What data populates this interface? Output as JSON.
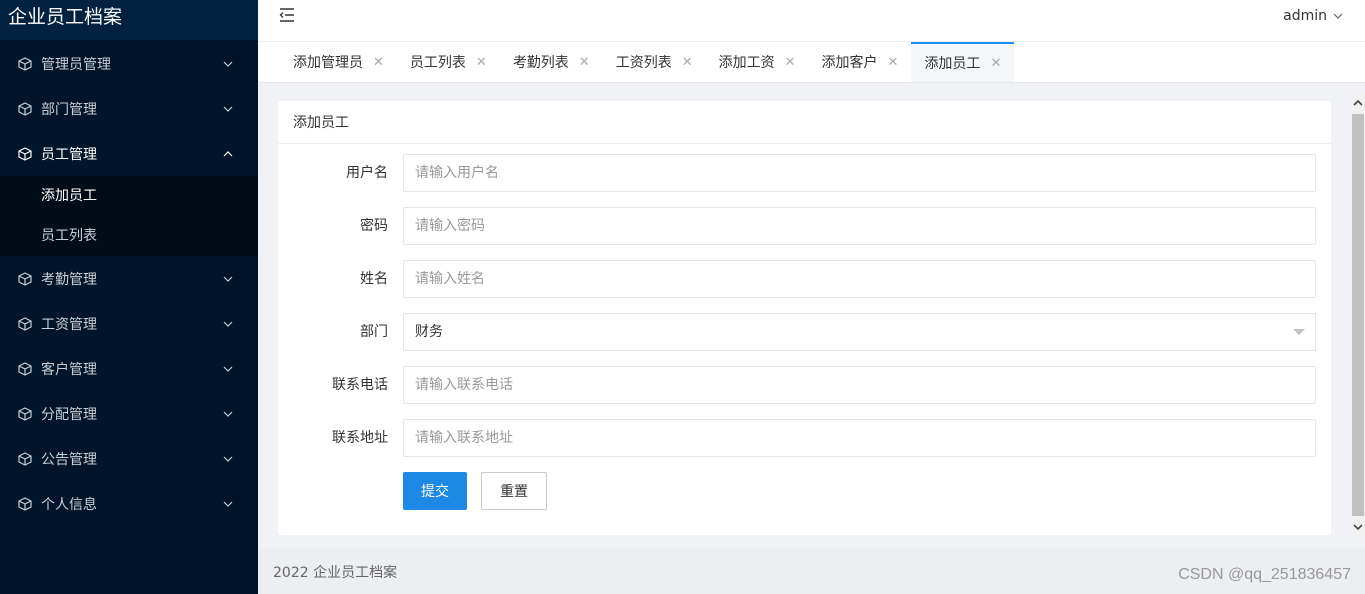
{
  "app": {
    "title": "企业员工档案"
  },
  "sidebar": {
    "items": [
      {
        "label": "管理员管理",
        "open": false
      },
      {
        "label": "部门管理",
        "open": false
      },
      {
        "label": "员工管理",
        "open": true,
        "children": [
          "添加员工",
          "员工列表"
        ]
      },
      {
        "label": "考勤管理",
        "open": false
      },
      {
        "label": "工资管理",
        "open": false
      },
      {
        "label": "客户管理",
        "open": false
      },
      {
        "label": "分配管理",
        "open": false
      },
      {
        "label": "公告管理",
        "open": false
      },
      {
        "label": "个人信息",
        "open": false
      }
    ]
  },
  "header": {
    "user": "admin"
  },
  "tabs": [
    {
      "label": "添加管理员"
    },
    {
      "label": "员工列表"
    },
    {
      "label": "考勤列表"
    },
    {
      "label": "工资列表"
    },
    {
      "label": "添加工资"
    },
    {
      "label": "添加客户"
    },
    {
      "label": "添加员工",
      "active": true
    }
  ],
  "form": {
    "title": "添加员工",
    "fields": [
      {
        "label": "用户名",
        "placeholder": "请输入用户名",
        "value": ""
      },
      {
        "label": "密码",
        "placeholder": "请输入密码",
        "value": ""
      },
      {
        "label": "姓名",
        "placeholder": "请输入姓名",
        "value": ""
      },
      {
        "label": "部门",
        "value": "财务"
      },
      {
        "label": "联系电话",
        "placeholder": "请输入联系电话",
        "value": ""
      },
      {
        "label": "联系地址",
        "placeholder": "请输入联系地址",
        "value": ""
      }
    ],
    "submit_label": "提交",
    "reset_label": "重置"
  },
  "footer": {
    "text": "2022 企业员工档案"
  },
  "watermark": "CSDN @qq_251836457",
  "colors": {
    "sidebar_bg": "#001529",
    "primary": "#1e88e5",
    "tab_active_border": "#1890ff"
  },
  "icons": {
    "menu": "cube-icon",
    "expand": "chevron-down-icon",
    "collapse": "chevron-up-icon",
    "toggle": "menu-fold-icon"
  }
}
